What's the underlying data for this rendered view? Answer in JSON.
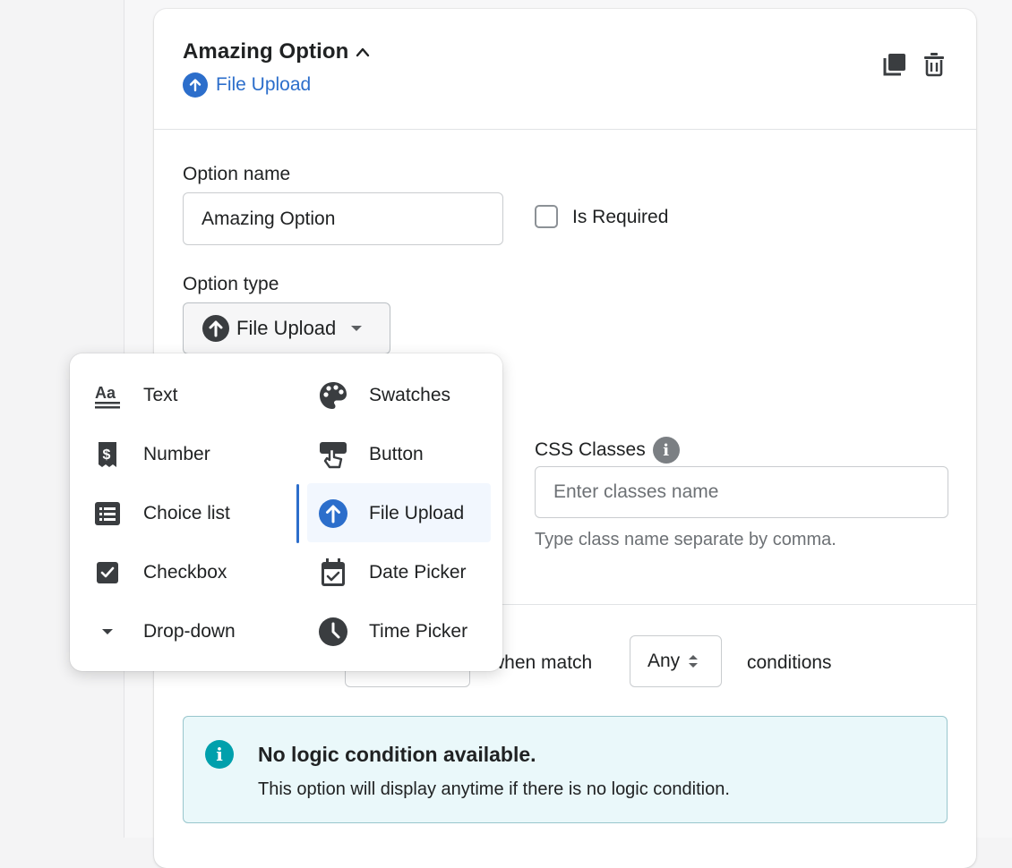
{
  "option": {
    "title": "Amazing Option",
    "title_chevron": "^",
    "type_label": "File Upload"
  },
  "form": {
    "option_name_label": "Option name",
    "option_name_value": "Amazing Option",
    "is_required_label": "Is Required",
    "option_type_label": "Option type",
    "option_type_value": "File Upload",
    "css_classes_label": "CSS Classes",
    "css_classes_placeholder": "Enter classes name",
    "css_classes_help": "Type class name separate by comma."
  },
  "logic": {
    "when_match_text": "when match",
    "match_value": "Any",
    "conditions_text": "conditions"
  },
  "banner": {
    "title": "No logic condition available.",
    "body": "This option will display anytime if there is no logic condition."
  },
  "menu": {
    "left": [
      {
        "label": "Text",
        "icon": "text-format-icon"
      },
      {
        "label": "Number",
        "icon": "receipt-dollar-icon"
      },
      {
        "label": "Choice list",
        "icon": "list-icon"
      },
      {
        "label": "Checkbox",
        "icon": "checkbox-icon"
      },
      {
        "label": "Drop-down",
        "icon": "caret-down-icon"
      }
    ],
    "right": [
      {
        "label": "Swatches",
        "icon": "palette-icon"
      },
      {
        "label": "Button",
        "icon": "button-click-icon"
      },
      {
        "label": "File Upload",
        "icon": "upload-icon",
        "selected": true
      },
      {
        "label": "Date Picker",
        "icon": "calendar-check-icon"
      },
      {
        "label": "Time Picker",
        "icon": "clock-icon"
      }
    ]
  },
  "colors": {
    "accent": "#2c6ecb",
    "info": "#00a0ac",
    "banner_bg": "#eaf8fa"
  }
}
